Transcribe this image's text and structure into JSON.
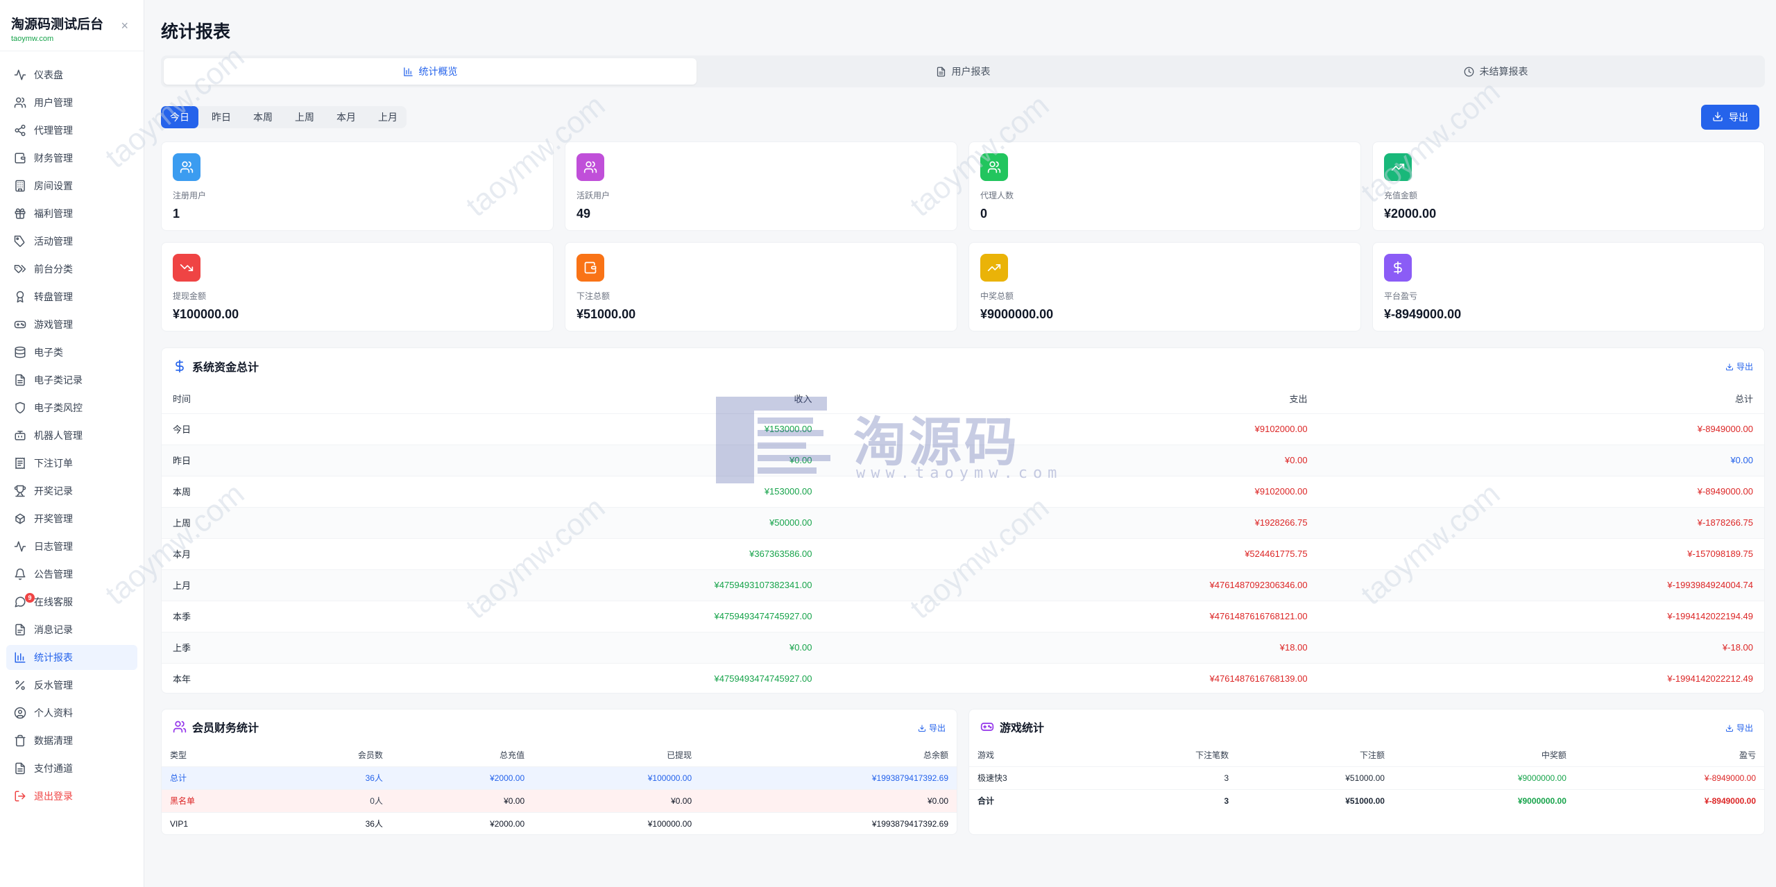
{
  "sidebar": {
    "title": "淘源码测试后台",
    "subtitle": "taoymw.com",
    "close": "×",
    "items": [
      {
        "label": "仪表盘",
        "icon": "activity-icon"
      },
      {
        "label": "用户管理",
        "icon": "users-icon"
      },
      {
        "label": "代理管理",
        "icon": "share-icon"
      },
      {
        "label": "财务管理",
        "icon": "wallet-icon"
      },
      {
        "label": "房间设置",
        "icon": "building-icon"
      },
      {
        "label": "福利管理",
        "icon": "gift-icon"
      },
      {
        "label": "活动管理",
        "icon": "tag-icon"
      },
      {
        "label": "前台分类",
        "icon": "tags-icon"
      },
      {
        "label": "转盘管理",
        "icon": "award-icon"
      },
      {
        "label": "游戏管理",
        "icon": "gamepad-icon"
      },
      {
        "label": "电子类",
        "icon": "database-icon"
      },
      {
        "label": "电子类记录",
        "icon": "file-icon"
      },
      {
        "label": "电子类风控",
        "icon": "shield-icon"
      },
      {
        "label": "机器人管理",
        "icon": "bot-icon"
      },
      {
        "label": "下注订单",
        "icon": "receipt-icon"
      },
      {
        "label": "开奖记录",
        "icon": "trophy-icon"
      },
      {
        "label": "开奖管理",
        "icon": "dice-icon"
      },
      {
        "label": "日志管理",
        "icon": "pulse-icon"
      },
      {
        "label": "公告管理",
        "icon": "bell-icon"
      },
      {
        "label": "在线客服",
        "icon": "chat-icon",
        "badge": "9"
      },
      {
        "label": "消息记录",
        "icon": "doc-icon"
      },
      {
        "label": "统计报表",
        "icon": "chart-icon",
        "active": true
      },
      {
        "label": "反水管理",
        "icon": "percent-icon"
      },
      {
        "label": "个人资料",
        "icon": "user-circle-icon"
      },
      {
        "label": "数据清理",
        "icon": "trash-icon"
      },
      {
        "label": "支付通道",
        "icon": "doc2-icon"
      },
      {
        "label": "退出登录",
        "icon": "logout-icon",
        "logout": true
      }
    ]
  },
  "page": {
    "title": "统计报表"
  },
  "tabs": [
    {
      "label": "统计概览",
      "icon": "bar-chart-icon",
      "active": true
    },
    {
      "label": "用户报表",
      "icon": "file-text-icon"
    },
    {
      "label": "未结算报表",
      "icon": "clock-icon"
    }
  ],
  "periods": [
    {
      "label": "今日",
      "active": true
    },
    {
      "label": "昨日"
    },
    {
      "label": "本周"
    },
    {
      "label": "上周"
    },
    {
      "label": "本月"
    },
    {
      "label": "上月"
    }
  ],
  "export_label": "导出",
  "cards": [
    {
      "label": "注册用户",
      "value": "1",
      "icon": "users-icon",
      "color": "#3b9cf0"
    },
    {
      "label": "活跃用户",
      "value": "49",
      "icon": "users-icon",
      "color": "#c04fd9"
    },
    {
      "label": "代理人数",
      "value": "0",
      "icon": "users-icon",
      "color": "#22c55e"
    },
    {
      "label": "充值金额",
      "value": "¥2000.00",
      "icon": "trending-up-icon",
      "color": "#19b87a"
    },
    {
      "label": "提现金额",
      "value": "¥100000.00",
      "icon": "trending-down-icon",
      "color": "#ef4444"
    },
    {
      "label": "下注总额",
      "value": "¥51000.00",
      "icon": "wallet-icon",
      "color": "#f97316"
    },
    {
      "label": "中奖总额",
      "value": "¥9000000.00",
      "icon": "trending-up-icon",
      "color": "#eab308"
    },
    {
      "label": "平台盈亏",
      "value": "¥-8949000.00",
      "icon": "dollar-icon",
      "color": "#8b5cf6"
    }
  ],
  "fund": {
    "title": "系统资金总计",
    "export": "导出",
    "headers": [
      "时间",
      "收入",
      "支出",
      "总计"
    ],
    "rows": [
      {
        "period": "今日",
        "income": "¥153000.00",
        "expense": "¥9102000.00",
        "total": "¥-8949000.00",
        "total_color": "r"
      },
      {
        "period": "昨日",
        "income": "¥0.00",
        "expense": "¥0.00",
        "total": "¥0.00",
        "total_color": "b"
      },
      {
        "period": "本周",
        "income": "¥153000.00",
        "expense": "¥9102000.00",
        "total": "¥-8949000.00",
        "total_color": "r"
      },
      {
        "period": "上周",
        "income": "¥50000.00",
        "expense": "¥1928266.75",
        "total": "¥-1878266.75",
        "total_color": "r"
      },
      {
        "period": "本月",
        "income": "¥367363586.00",
        "expense": "¥524461775.75",
        "total": "¥-157098189.75",
        "total_color": "r"
      },
      {
        "period": "上月",
        "income": "¥4759493107382341.00",
        "expense": "¥4761487092306346.00",
        "total": "¥-1993984924004.74",
        "total_color": "r"
      },
      {
        "period": "本季",
        "income": "¥4759493474745927.00",
        "expense": "¥4761487616768121.00",
        "total": "¥-1994142022194.49",
        "total_color": "r"
      },
      {
        "period": "上季",
        "income": "¥0.00",
        "expense": "¥18.00",
        "total": "¥-18.00",
        "total_color": "r"
      },
      {
        "period": "本年",
        "income": "¥4759493474745927.00",
        "expense": "¥4761487616768139.00",
        "total": "¥-1994142022212.49",
        "total_color": "r"
      }
    ]
  },
  "members": {
    "title": "会员财务统计",
    "export": "导出",
    "headers": [
      "类型",
      "会员数",
      "总充值",
      "已提现",
      "总余额"
    ],
    "rows": [
      {
        "type": "总计",
        "count": "36人",
        "recharge": "¥2000.00",
        "withdrawn": "¥100000.00",
        "balance": "¥1993879417392.69",
        "style": "total-row"
      },
      {
        "type": "黑名单",
        "count": "0人",
        "recharge": "¥0.00",
        "withdrawn": "¥0.00",
        "balance": "¥0.00",
        "style": "black-row"
      },
      {
        "type": "VIP1",
        "count": "36人",
        "recharge": "¥2000.00",
        "withdrawn": "¥100000.00",
        "balance": "¥1993879417392.69",
        "style": "plain-row"
      }
    ]
  },
  "games": {
    "title": "游戏统计",
    "export": "导出",
    "headers": [
      "游戏",
      "下注笔数",
      "下注额",
      "中奖额",
      "盈亏"
    ],
    "rows": [
      {
        "game": "极速快3",
        "bets": "3",
        "amount": "¥51000.00",
        "win": "¥9000000.00",
        "profit": "¥-8949000.00",
        "bold": false
      },
      {
        "game": "合计",
        "bets": "3",
        "amount": "¥51000.00",
        "win": "¥9000000.00",
        "profit": "¥-8949000.00",
        "bold": true
      }
    ]
  },
  "watermark": {
    "brand": "淘源码",
    "url": "www.taoymw.com",
    "diag": "taoymw.com"
  }
}
